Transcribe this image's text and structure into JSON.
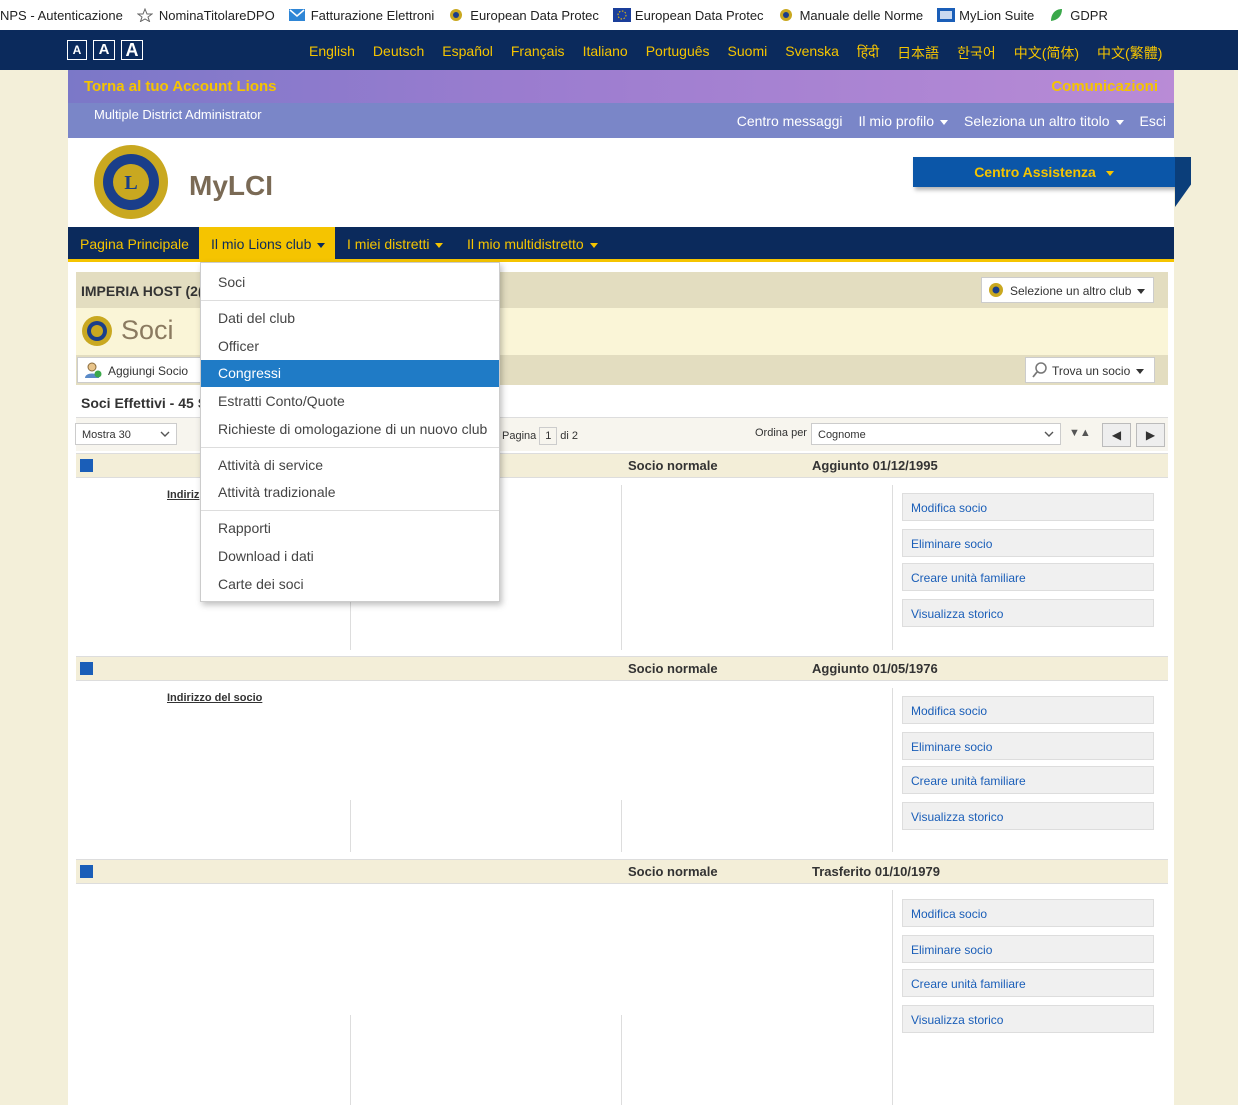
{
  "bookmarks": [
    {
      "label": "NPS - Autenticazione",
      "icon": "none"
    },
    {
      "label": "NominaTitolareDPO",
      "icon": "star-icon"
    },
    {
      "label": "Fatturazione Elettroni",
      "icon": "mail-icon"
    },
    {
      "label": "European Data Protec",
      "icon": "lions-icon"
    },
    {
      "label": "European Data Protec",
      "icon": "eu-flag-icon"
    },
    {
      "label": "Manuale delle Norme",
      "icon": "lions-icon"
    },
    {
      "label": "MyLion Suite",
      "icon": "app-icon"
    },
    {
      "label": "GDPR",
      "icon": "leaf-icon"
    }
  ],
  "font_size_buttons": [
    "A",
    "A",
    "A"
  ],
  "languages": [
    "English",
    "Deutsch",
    "Español",
    "Français",
    "Italiano",
    "Português",
    "Suomi",
    "Svenska",
    "हिंदी",
    "日本語",
    "한국어",
    "中文(简体)",
    "中文(繁體)"
  ],
  "header": {
    "back_link": "Torna al tuo Account Lions",
    "communications": "Comunicazioni",
    "role": "Multiple District Administrator",
    "messages": "Centro messaggi",
    "profile": "Il mio profilo",
    "select_title": "Seleziona un altro titolo",
    "logout": "Esci"
  },
  "brand": {
    "name": "MyLCI",
    "assist": "Centro Assistenza"
  },
  "nav": {
    "home": "Pagina Principale",
    "my_club": "Il mio Lions club",
    "my_districts": "I miei distretti",
    "my_multidistrict": "Il mio multidistretto"
  },
  "dropdown": [
    "Soci",
    "Dati del club",
    "Officer",
    "Congressi",
    "Estratti Conto/Quote",
    "Richieste di omologazione di un nuovo club",
    "Attività di service",
    "Attività tradizionale",
    "Rapporti",
    "Download i dati",
    "Carte dei soci"
  ],
  "dropdown_selected": "Congressi",
  "club": {
    "name": "IMPERIA HOST (2(",
    "select_other": "Selezione un altro club"
  },
  "page_title": "Soci",
  "toolbar": {
    "add": "Aggiungi Socio",
    "find": "Trova un socio"
  },
  "effective": "Soci Effettivi - 45 S",
  "pager": {
    "show": "Mostra 30",
    "page_label": "Pagina",
    "page": "1",
    "of": "di 2",
    "order_label": "Ordina per",
    "order_value": "Cognome"
  },
  "members": [
    {
      "type": "Socio normale",
      "date": "Aggiunto 01/12/1995",
      "addr": "Indiriz"
    },
    {
      "type": "Socio normale",
      "date": "Aggiunto 01/05/1976",
      "addr": "Indirizzo del socio"
    },
    {
      "type": "Socio normale",
      "date": "Trasferito 01/10/1979",
      "addr": ""
    }
  ],
  "member_actions": [
    "Modifica socio",
    "Eliminare socio",
    "Creare unità familiare",
    "Visualizza storico"
  ],
  "colors": {
    "navy": "#0b2a5c",
    "gold": "#f5c400",
    "blue": "#1a5eb8",
    "highlight": "#1f7bc6"
  }
}
